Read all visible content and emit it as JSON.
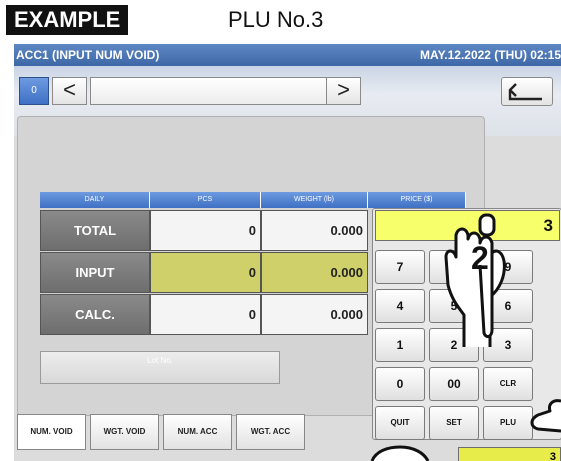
{
  "caption": {
    "tag": "EXAMPLE",
    "title": "PLU No.3"
  },
  "titlebar": {
    "left": "ACC1 (INPUT NUM VOID)",
    "right": "MAY.12.2022 (THU) 02:15"
  },
  "nav": {
    "page_badge": "0",
    "prev_arrow": "<",
    "next_arrow": ">",
    "back_icon": "return-arrow-icon"
  },
  "table": {
    "headers": [
      "DAILY",
      "PCS",
      "WEIGHT (lb)",
      "PRICE ($)"
    ],
    "rows": [
      {
        "label": "TOTAL",
        "pcs": "0",
        "weight": "0.000"
      },
      {
        "label": "INPUT",
        "pcs": "0",
        "weight": "0.000"
      },
      {
        "label": "CALC.",
        "pcs": "0",
        "weight": "0.000"
      }
    ]
  },
  "lot": {
    "label": "Lot No."
  },
  "tabs": [
    "NUM. VOID",
    "WGT. VOID",
    "NUM. ACC",
    "WGT. ACC"
  ],
  "keypad": {
    "display": "3",
    "keys": [
      [
        "7",
        "8",
        "9"
      ],
      [
        "4",
        "5",
        "6"
      ],
      [
        "1",
        "2",
        "3"
      ],
      [
        "0",
        "00",
        "CLR"
      ],
      [
        "QUIT",
        "SET",
        "PLU"
      ]
    ]
  },
  "bottom_value": "3",
  "callout": {
    "number": "2"
  },
  "colors": {
    "titlebar": "#4a74b4",
    "input_highlight": "#cfd06a",
    "display": "#f7ff6a",
    "accent_red": "#d33b2e"
  }
}
